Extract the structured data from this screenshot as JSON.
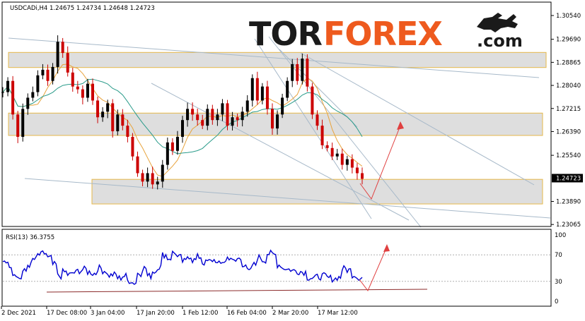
{
  "header": {
    "symbol": "USDCAD",
    "info": "USDCADi,H4  1.24675 1.24734 1.24648 1.24723"
  },
  "logo": {
    "part1": "TOR",
    "part2": "FOREX",
    "part3": ".com",
    "icon": "bull-icon",
    "colors": {
      "dark": "#1a1a1a",
      "accent": "#ee5a1e"
    }
  },
  "rsi_label": "RSI(13) 36.3755",
  "current_price_label": "1.24723",
  "chart_data": [
    {
      "type": "line",
      "series": [
        {
          "values": [
            1.278,
            1.282,
            1.27,
            1.262,
            1.272,
            1.276,
            1.278,
            1.284,
            1.286,
            1.282,
            1.287,
            1.296,
            1.292,
            1.285,
            1.28,
            1.279,
            1.276,
            1.281,
            1.275,
            1.269,
            1.271,
            1.274,
            1.264,
            1.27,
            1.266,
            1.262,
            1.255,
            1.249,
            1.246,
            1.249,
            1.245,
            1.246,
            1.252,
            1.26,
            1.257,
            1.262,
            1.268,
            1.272,
            1.27,
            1.268,
            1.266,
            1.272,
            1.268,
            1.27,
            1.274,
            1.266,
            1.269,
            1.268,
            1.271,
            1.275,
            1.283,
            1.275,
            1.28,
            1.272,
            1.265,
            1.27,
            1.276,
            1.282,
            1.288,
            1.282,
            1.29,
            1.28,
            1.27,
            1.266,
            1.259,
            1.258,
            1.255,
            1.256,
            1.252,
            1.254,
            1.251,
            1.249,
            1.247
          ]
        },
        {
          "values": []
        },
        {
          "values": []
        }
      ],
      "x_labels": [
        "2 Dec 2021",
        "17 Dec 08:00",
        "3 Jan 04:00",
        "17 Jan 20:00",
        "1 Feb 12:00",
        "16 Feb 04:00",
        "2 Mar 20:00",
        "17 Mar 12:00"
      ],
      "y_ticks": [
        "1.30540",
        "1.29690",
        "1.28865",
        "1.28040",
        "1.27215",
        "1.26390",
        "1.25540",
        "1.24723",
        "1.23890",
        "1.23065"
      ],
      "ylim": [
        1.2307,
        1.3054
      ],
      "grid": false,
      "colors": {
        "up": "#cc0000",
        "down": "#000000",
        "ma_fast": "#e8a33c",
        "ma_slow": "#2a9b8a",
        "zone": "#d8d8d8",
        "zone_border": "#e6b84a",
        "trendline": "#a7b9c9",
        "arrow": "#e04040",
        "price_tag": "#000000"
      }
    },
    {
      "type": "line",
      "series": [
        {
          "values": [
            62,
            55,
            42,
            35,
            45,
            55,
            63,
            70,
            72,
            65,
            55,
            38,
            44,
            40,
            43,
            46,
            48,
            44,
            42,
            50,
            46,
            39,
            40,
            35,
            38,
            31,
            28,
            42,
            50,
            38,
            45,
            52,
            70,
            65,
            73,
            66,
            60,
            68,
            62,
            67,
            58,
            60,
            62,
            56,
            60,
            66,
            60,
            64,
            56,
            45,
            55,
            66,
            62,
            72,
            70,
            55,
            50,
            48,
            46,
            45,
            44,
            36,
            35,
            37,
            38,
            35,
            34,
            36,
            49,
            47,
            40,
            36,
            36
          ]
        }
      ],
      "levels": [
        "100",
        "70",
        "30",
        "0"
      ],
      "ylim": [
        0,
        100
      ],
      "colors": {
        "line": "#0000d0",
        "support": "#8b2a2a",
        "arrow": "#e04040"
      }
    }
  ]
}
